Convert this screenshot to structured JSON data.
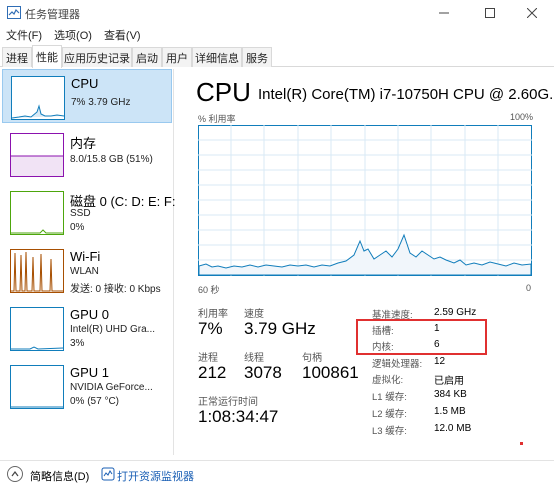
{
  "window": {
    "title": "任务管理器"
  },
  "menu": [
    "文件(F)",
    "选项(O)",
    "查看(V)"
  ],
  "tabs": [
    "进程",
    "性能",
    "应用历史记录",
    "启动",
    "用户",
    "详细信息",
    "服务"
  ],
  "active_tab": "性能",
  "sidebar": [
    {
      "title": "CPU",
      "line1": "7% 3.79 GHz",
      "line2": "",
      "color": "#117dbb"
    },
    {
      "title": "内存",
      "line1": "8.0/15.8 GB (51%)",
      "line2": "",
      "color": "#8b12ae"
    },
    {
      "title": "磁盘 0 (C: D: E: F:",
      "line1": "SSD",
      "line2": "0%",
      "color": "#4da60c"
    },
    {
      "title": "Wi-Fi",
      "line1": "WLAN",
      "line2": "发送: 0 接收: 0 Kbps",
      "color": "#a74f01"
    },
    {
      "title": "GPU 0",
      "line1": "Intel(R) UHD Gra...",
      "line2": "3%",
      "color": "#117dbb"
    },
    {
      "title": "GPU 1",
      "line1": "NVIDIA GeForce...",
      "line2": "0% (57 °C)",
      "color": "#117dbb"
    }
  ],
  "cpu": {
    "title": "CPU",
    "model": "Intel(R) Core(TM) i7-10750H CPU @ 2.60G...",
    "util_label": "% 利用率",
    "util_max": "100%",
    "axis_left": "60 秒",
    "axis_right": "0",
    "graph_color": "#117dbb",
    "stats": {
      "utilization_label": "利用率",
      "utilization": "7%",
      "speed_label": "速度",
      "speed": "3.79 GHz",
      "processes_label": "进程",
      "processes": "212",
      "threads_label": "线程",
      "threads": "3078",
      "handles_label": "句柄",
      "handles": "100861",
      "uptime_label": "正常运行时间",
      "uptime": "1:08:34:47"
    },
    "details": [
      {
        "key": "基准速度:",
        "value": "2.59 GHz"
      },
      {
        "key": "插槽:",
        "value": "1"
      },
      {
        "key": "内核:",
        "value": "6"
      },
      {
        "key": "逻辑处理器:",
        "value": "12"
      },
      {
        "key": "虚拟化:",
        "value": "已启用"
      },
      {
        "key": "L1 缓存:",
        "value": "384 KB"
      },
      {
        "key": "L2 缓存:",
        "value": "1.5 MB"
      },
      {
        "key": "L3 缓存:",
        "value": "12.0 MB"
      }
    ]
  },
  "footer": {
    "fewer_details": "简略信息(D)",
    "open_monitor": "打开资源监视器"
  }
}
